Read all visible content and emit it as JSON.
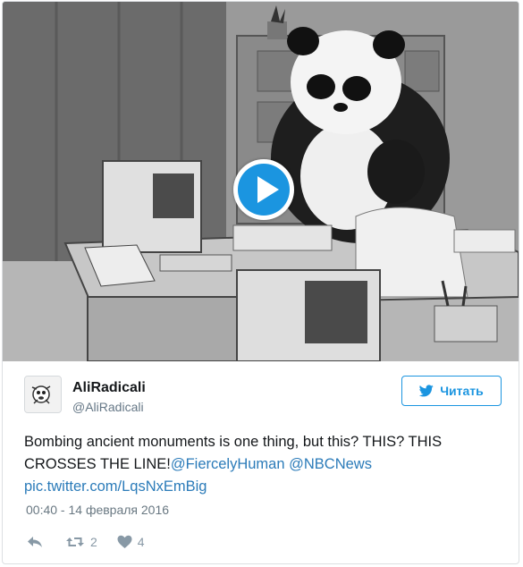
{
  "media": {
    "description_icon": "play-icon"
  },
  "author": {
    "display_name": "AliRadicali",
    "screen_name": "@AliRadicali"
  },
  "follow_button": {
    "label": "Читать",
    "icon": "twitter-bird-icon"
  },
  "tweet": {
    "text_main": "Bombing ancient monuments is one thing, but this? THIS? THIS CROSSES THE LINE!",
    "mention_1": "@FiercelyHuman",
    "mention_2": "@NBCNews",
    "pic_link": "pic.twitter.com/LqsNxEmBig",
    "timestamp": "00:40 - 14 февраля 2016"
  },
  "actions": {
    "reply_icon": "reply-icon",
    "retweet_icon": "retweet-icon",
    "retweet_count": "2",
    "like_icon": "heart-icon",
    "like_count": "4"
  },
  "colors": {
    "accent": "#1b95e0",
    "link": "#2b7bb9",
    "muted": "#8899a6",
    "text": "#14171a"
  }
}
